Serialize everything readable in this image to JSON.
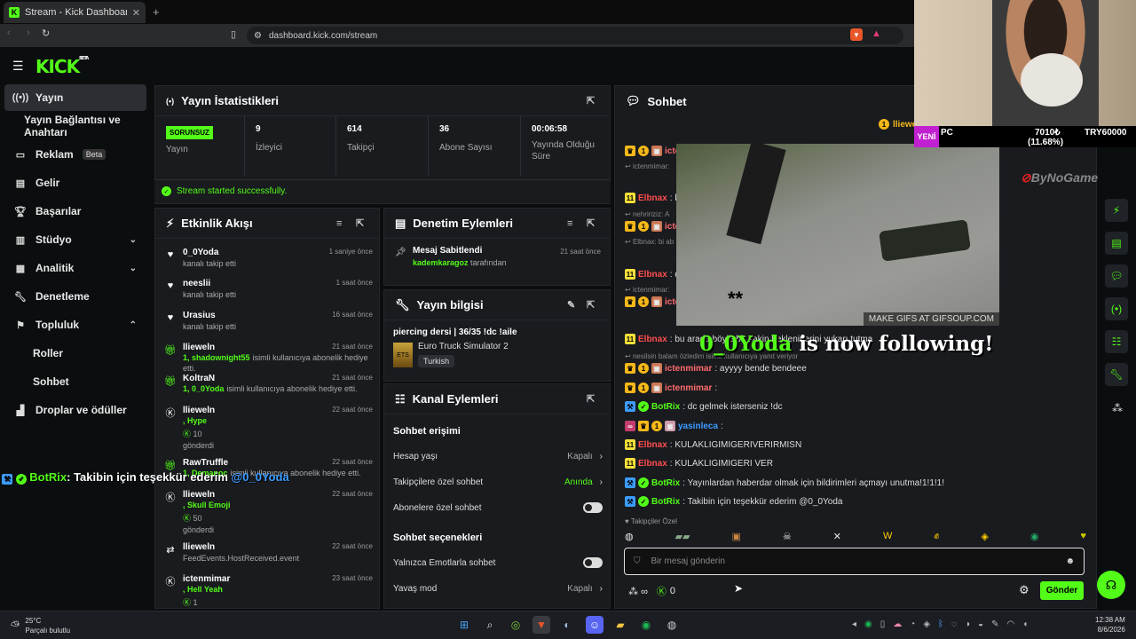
{
  "browser": {
    "tab_title": "Stream - Kick Dashboard",
    "url": "dashboard.kick.com/stream"
  },
  "brand": {
    "logo": "KICK",
    "logo_sup": "BETA",
    "accent": "#53fc18"
  },
  "sidebar": {
    "items": [
      {
        "label": "Yayın",
        "icon": "broadcast-icon"
      },
      {
        "label": "Yayın Bağlantısı ve Anahtarı"
      },
      {
        "label": "Reklam",
        "badge": "Beta",
        "icon": "tv-icon"
      },
      {
        "label": "Gelir",
        "icon": "wallet-icon"
      },
      {
        "label": "Başarılar",
        "icon": "trophy-icon"
      },
      {
        "label": "Stüdyo",
        "icon": "studio-icon"
      },
      {
        "label": "Analitik",
        "icon": "chart-icon"
      },
      {
        "label": "Denetleme",
        "icon": "wrench-icon"
      },
      {
        "label": "Topluluk",
        "icon": "community-icon"
      },
      {
        "label": "Roller"
      },
      {
        "label": "Sohbet"
      },
      {
        "label": "Droplar ve ödüller",
        "icon": "drops-icon"
      }
    ]
  },
  "overlay_alert": {
    "user": "BotRix",
    "text": ": Takibin için teşekkür ederim",
    "mention": "@0_0Yoda"
  },
  "stats_panel": {
    "title": "Yayın İstatistikleri",
    "status_badge": "SORUNSUZ",
    "status_label": "Yayın",
    "stats": [
      {
        "value": "9",
        "label": "İzleyici"
      },
      {
        "value": "614",
        "label": "Takipçi"
      },
      {
        "value": "36",
        "label": "Abone Sayısı"
      },
      {
        "value": "00:06:58",
        "label": "Yayında Olduğu Süre"
      }
    ],
    "success_msg": "Stream started successfully."
  },
  "activity_panel": {
    "title": "Etkinlik Akışı",
    "items": [
      {
        "name": "0_0Yoda",
        "desc": "kanalı takip etti",
        "time": "1 saniye önce",
        "icon": "heart-icon"
      },
      {
        "name": "neeslii",
        "desc": "kanalı takip etti",
        "time": "1 saat önce",
        "icon": "heart-icon"
      },
      {
        "name": "Urasius",
        "desc": "kanalı takip etti",
        "time": "16 saat önce",
        "icon": "heart-icon"
      },
      {
        "name": "llieweln",
        "green": "1, shadownight55",
        "desc": "isimli kullanıcıya abonelik hediye etti.",
        "time": "21 saat önce",
        "icon": "gift-icon"
      },
      {
        "name": "KoltraN",
        "green": "1, 0_0Yoda",
        "desc": "isimli kullanıcıya abonelik hediye etti.",
        "time": "21 saat önce",
        "icon": "gift-icon"
      },
      {
        "name": "llieweln",
        "green": ", Hype",
        "desc2": "10",
        "desc": "gönderdi",
        "time": "22 saat önce",
        "icon": "kick-coin-icon"
      },
      {
        "name": "RawTruffle",
        "green": "1, Demanoc",
        "desc": "isimli kullanıcıya abonelik hediye etti.",
        "time": "22 saat önce",
        "icon": "gift-icon"
      },
      {
        "name": "llieweln",
        "green": ", Skull Emoji",
        "desc2": "50",
        "desc": "gönderdi",
        "time": "22 saat önce",
        "icon": "kick-coin-icon"
      },
      {
        "name": "llieweln",
        "desc": "FeedEvents.HostReceived.event",
        "time": "22 saat önce",
        "icon": "host-icon"
      },
      {
        "name": "ictenmimar",
        "green": ", Hell Yeah",
        "desc2": "1",
        "desc": "",
        "time": "23 saat önce",
        "icon": "kick-coin-icon"
      }
    ]
  },
  "moderation_panel": {
    "title": "Denetim Eylemleri",
    "item": {
      "title": "Mesaj Sabitlendi",
      "user": "kademkaragoz",
      "suffix": "tarafından",
      "time": "21 saat önce"
    }
  },
  "stream_info": {
    "title": "Yayın bilgisi",
    "stream_title": "piercing dersi | 36/35 !dc !aile",
    "game": "Euro Truck Simulator 2",
    "language": "Turkish"
  },
  "channel_actions": {
    "title": "Kanal Eylemleri",
    "chat_access": "Sohbet erişimi",
    "rows1": [
      {
        "label": "Hesap yaşı",
        "value": "Kapalı"
      },
      {
        "label": "Takipçilere özel sohbet",
        "value": "Anında",
        "green": true
      },
      {
        "label": "Abonelere özel sohbet",
        "toggle": true
      }
    ],
    "chat_options": "Sohbet seçenekleri",
    "rows2": [
      {
        "label": "Yalnızca Emotlarla sohbet",
        "toggle": true
      },
      {
        "label": "Yavaş mod",
        "value": "Kapalı"
      }
    ]
  },
  "chat": {
    "title": "Sohbet",
    "pinned_user": "llieweln",
    "lines": [
      {
        "user": "ictenmimar",
        "color": "#ff6b6b",
        "text": ""
      },
      {
        "reply": "ictenmimar:"
      },
      {
        "user": "Elbnax",
        "color": "#ff4d4d",
        "text": ": bu"
      },
      {
        "reply": "nehririziz: A"
      },
      {
        "user": "ictenmimar",
        "color": "#ff6b6b",
        "text": ":"
      },
      {
        "reply": "Elbnax: bi ab"
      },
      {
        "user": "Elbnax",
        "color": "#ff4d4d",
        "text": ": d"
      },
      {
        "reply": "ictenmimar:"
      },
      {
        "user": "ictenmimar",
        "color": "#ff6b6b",
        "text": ""
      },
      {
        "user": "Elbnax",
        "color": "#ff4d4d",
        "text": ": bu arada böyle bir sakin beklenirlerini yukarı tutma"
      },
      {
        "reply": "nesilsin balam özledim isimli kullanıcıya yanıt veriyor"
      },
      {
        "user": "ictenmimar",
        "color": "#ff6b6b",
        "text": ": ayyyy bende bendeee"
      },
      {
        "user": "ictenmimar",
        "color": "#ff6b6b",
        "text": ":"
      },
      {
        "user": "BotRix",
        "color": "#53fc18",
        "text": ": dc gelmek isterseniz !dc"
      },
      {
        "user": "yasinleca",
        "color": "#3c9cff",
        "text": ":"
      },
      {
        "user": "Elbnax",
        "color": "#ff4d4d",
        "text": ": KULAKLIGIMIGERIVERIRMISN"
      },
      {
        "user": "Elbnax",
        "color": "#ff4d4d",
        "text": ": KULAKLIGIMIGERI VER"
      },
      {
        "user": "BotRix",
        "color": "#53fc18",
        "text": ": Yayınlardan haberdar olmak için bildirimleri açmayı unutma!1!1!1!"
      },
      {
        "user": "BotRix",
        "color": "#53fc18",
        "text": ": Takibin için teşekkür ederim @0_0Yoda"
      }
    ],
    "follower_only": "Takipçiler Özel",
    "input_placeholder": "Bir mesaj gönderin",
    "infinity": "∞",
    "coins": "0",
    "send": "Gönder"
  },
  "gif_overlay": {
    "caption": "MAKE GIFS AT GIFSOUP.COM",
    "stars": "**"
  },
  "follow_overlay": {
    "user": "0_0Yoda",
    "text": " is now following!"
  },
  "webcam_overlay": {
    "badge": "YENİ",
    "pc": "PC",
    "amount": "7010₺",
    "percent": "(11.68%)",
    "goal": "TRY60000",
    "sponsor": "ByNoGame"
  },
  "taskbar": {
    "weather_temp": "25°C",
    "weather_desc": "Parçalı bulutlu",
    "time": "12:38 AM",
    "date": "8/6/2026"
  }
}
